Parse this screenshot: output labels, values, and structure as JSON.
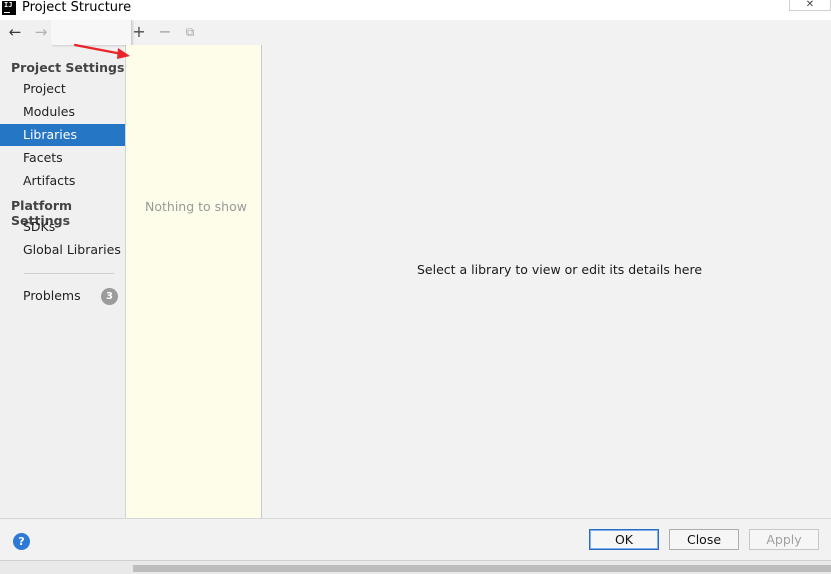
{
  "window": {
    "title": "Project Structure",
    "app_icon_text": "IJ",
    "close_glyph": "✕"
  },
  "nav": {
    "back_glyph": "←",
    "forward_glyph": "→",
    "project_settings_heading": "Project Settings",
    "project_items": [
      "Project",
      "Modules",
      "Libraries",
      "Facets",
      "Artifacts"
    ],
    "selected_item": "Libraries",
    "platform_settings_heading": "Platform Settings",
    "platform_items": [
      "SDKs",
      "Global Libraries"
    ],
    "problems_label": "Problems",
    "problems_count": "3"
  },
  "toolbar": {
    "add_glyph": "+",
    "remove_glyph": "−",
    "copy_glyph": "⧉"
  },
  "library_list": {
    "empty_text": "Nothing to show"
  },
  "details": {
    "empty_text": "Select a library to view or edit its details here"
  },
  "footer": {
    "help_glyph": "?",
    "ok_label": "OK",
    "close_label": "Close",
    "apply_label": "Apply"
  },
  "colors": {
    "selection": "#2676c6",
    "list_background": "#fdfdea",
    "annotation_arrow": "#e8262a",
    "help": "#2d7ad6"
  }
}
